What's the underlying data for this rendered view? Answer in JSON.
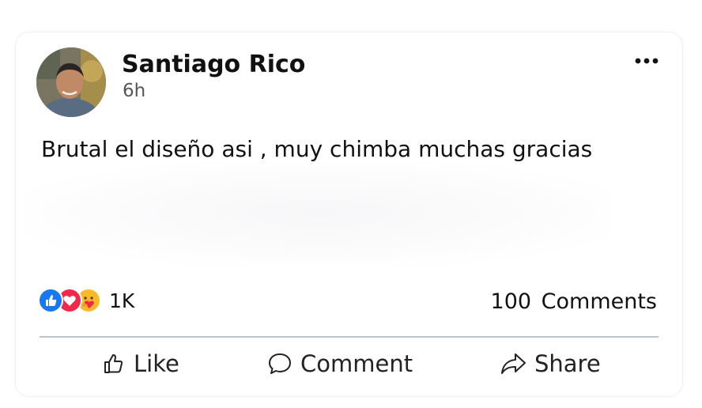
{
  "post": {
    "author": "Santiago Rico",
    "time": "6h",
    "text": "Brutal el diseño asi , muy chimba muchas gracias",
    "reactions": {
      "types": [
        "like-icon",
        "love-icon",
        "care-icon"
      ],
      "count": "1K"
    },
    "comments_count": "100 Comments"
  },
  "actions": {
    "like_label": "Like",
    "comment_label": "Comment",
    "share_label": "Share"
  },
  "colors": {
    "like_blue": "#1877f2",
    "love_red": "#f0284a",
    "care_yellow": "#f7b928",
    "divider": "#b9c4d2"
  }
}
